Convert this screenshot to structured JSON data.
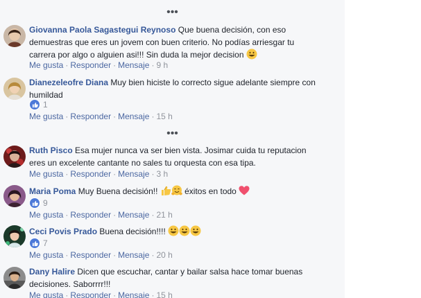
{
  "more_label": "•••",
  "comments": [
    {
      "name": "Giovanna Paola Sagastegui Reynoso",
      "text": "Que buena decisión, con eso demuestras que eres un jovem con buen criterio. No podías arriesgar tu carrera por algo o alguien asi!!! Sin duda la mejor decision",
      "like": "Me gusta",
      "reply": "Responder",
      "message": "Mensaje",
      "time": "9 h"
    },
    {
      "name": "Dianezeleofre Diana",
      "text": "Muy bien hiciste lo correcto sigue adelante siempre con humildad",
      "reactions": "1",
      "like": "Me gusta",
      "reply": "Responder",
      "message": "Mensaje",
      "time": "15 h"
    },
    {
      "name": "Ruth Pisco",
      "text": "Esa mujer nunca va ser bien vista. Josimar cuida tu reputacion eres un excelente cantante no sales tu orquesta con esa tipa.",
      "like": "Me gusta",
      "reply": "Responder",
      "message": "Mensaje",
      "time": "3 h"
    },
    {
      "name": "Maria Poma",
      "text": "Muy Buena decisión!!",
      "text_after": "éxitos en todo",
      "reactions": "9",
      "like": "Me gusta",
      "reply": "Responder",
      "message": "Mensaje",
      "time": "21 h"
    },
    {
      "name": "Ceci Povis Prado",
      "text": "Buena decisión!!!!",
      "reactions": "7",
      "like": "Me gusta",
      "reply": "Responder",
      "message": "Mensaje",
      "time": "20 h"
    },
    {
      "name": "Dany Halire",
      "text": "Dicen que escuchar, cantar y bailar salsa hace tomar buenas decisiones. Saborrrr!!!",
      "like": "Me gusta",
      "reply": "Responder",
      "message": "Mensaje",
      "time": "15 h"
    }
  ],
  "separator": "·",
  "colors": {
    "name": "#365899",
    "meta": "#90949c",
    "like_badge": "#4c79d8",
    "panel_bg": "#f6f7f9"
  }
}
